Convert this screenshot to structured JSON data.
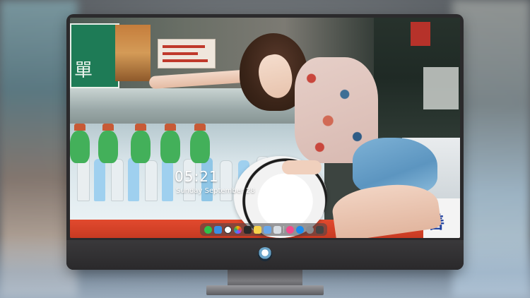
{
  "lockscreen": {
    "time": "05:21",
    "date": "Sunday September 28"
  },
  "wallpaper": {
    "sign_left_text": "單",
    "sign_right_text": "善"
  },
  "dock": {
    "items": [
      {
        "name": "messages",
        "icon": "speech-bubble-icon"
      },
      {
        "name": "finder",
        "icon": "finder-icon"
      },
      {
        "name": "clock",
        "icon": "clock-icon"
      },
      {
        "name": "photos",
        "icon": "photos-icon"
      },
      {
        "name": "final-cut",
        "icon": "clapper-icon"
      },
      {
        "name": "notes",
        "icon": "notes-icon"
      },
      {
        "name": "folder",
        "icon": "folder-icon"
      },
      {
        "name": "preview",
        "icon": "preview-icon"
      },
      {
        "name": "music",
        "icon": "music-note-icon"
      },
      {
        "name": "app-store",
        "icon": "app-store-icon"
      },
      {
        "name": "system-settings",
        "icon": "gear-icon"
      },
      {
        "name": "camera",
        "icon": "camera-icon"
      }
    ]
  },
  "colors": {
    "bezel": "#2b2a2c",
    "ledge_red": "#e24a2e",
    "sign_green": "#1e7b56",
    "sign_blue_text": "#1d3f9e"
  }
}
